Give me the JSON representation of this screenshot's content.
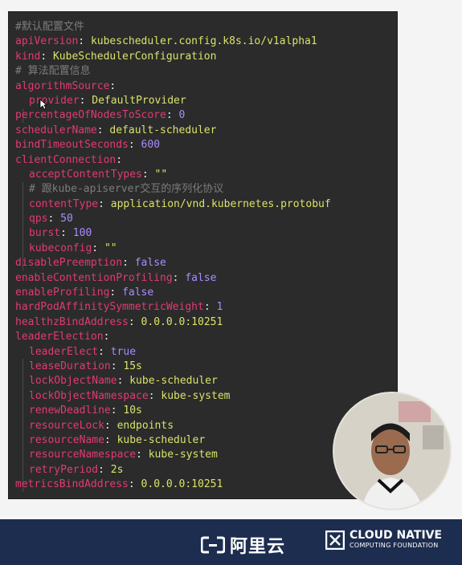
{
  "editor": {
    "lines": [
      {
        "indent": 0,
        "comment": "#默认配置文件"
      },
      {
        "indent": 0,
        "key": "apiVersion",
        "value": "kubescheduler.config.k8s.io/v1alpha1",
        "vtype": "v"
      },
      {
        "indent": 0,
        "key": "kind",
        "value": "KubeSchedulerConfiguration",
        "vtype": "v"
      },
      {
        "indent": 0,
        "comment": "# 算法配置信息"
      },
      {
        "indent": 0,
        "key": "algorithmSource",
        "value": "",
        "vtype": "v"
      },
      {
        "indent": 1,
        "key": "provider",
        "value": "DefaultProvider",
        "vtype": "v"
      },
      {
        "indent": 0,
        "key": "percentageOfNodesToScore",
        "value": "0",
        "vtype": "n"
      },
      {
        "indent": 0,
        "key": "schedulerName",
        "value": "default-scheduler",
        "vtype": "v"
      },
      {
        "indent": 0,
        "key": "bindTimeoutSeconds",
        "value": "600",
        "vtype": "n"
      },
      {
        "indent": 0,
        "key": "clientConnection",
        "value": "",
        "vtype": "v"
      },
      {
        "indent": 1,
        "key": "acceptContentTypes",
        "value": "\"\"",
        "vtype": "v"
      },
      {
        "indent": 1,
        "comment": "# 跟kube-apiserver交互的序列化协议"
      },
      {
        "indent": 1,
        "key": "contentType",
        "value": "application/vnd.kubernetes.protobuf",
        "vtype": "v"
      },
      {
        "indent": 1,
        "key": "qps",
        "value": "50",
        "vtype": "n"
      },
      {
        "indent": 1,
        "key": "burst",
        "value": "100",
        "vtype": "n"
      },
      {
        "indent": 1,
        "key": "kubeconfig",
        "value": "\"\"",
        "vtype": "v"
      },
      {
        "indent": 0,
        "key": "disablePreemption",
        "value": "false",
        "vtype": "n"
      },
      {
        "indent": 0,
        "key": "enableContentionProfiling",
        "value": "false",
        "vtype": "n"
      },
      {
        "indent": 0,
        "key": "enableProfiling",
        "value": "false",
        "vtype": "n"
      },
      {
        "indent": 0,
        "key": "hardPodAffinitySymmetricWeight",
        "value": "1",
        "vtype": "n"
      },
      {
        "indent": 0,
        "key": "healthzBindAddress",
        "value": "0.0.0.0:10251",
        "vtype": "v"
      },
      {
        "indent": 0,
        "key": "leaderElection",
        "value": "",
        "vtype": "v"
      },
      {
        "indent": 1,
        "key": "leaderElect",
        "value": "true",
        "vtype": "n"
      },
      {
        "indent": 1,
        "key": "leaseDuration",
        "value": "15s",
        "vtype": "v"
      },
      {
        "indent": 1,
        "key": "lockObjectName",
        "value": "kube-scheduler",
        "vtype": "v"
      },
      {
        "indent": 1,
        "key": "lockObjectNamespace",
        "value": "kube-system",
        "vtype": "v"
      },
      {
        "indent": 1,
        "key": "renewDeadline",
        "value": "10s",
        "vtype": "v"
      },
      {
        "indent": 1,
        "key": "resourceLock",
        "value": "endpoints",
        "vtype": "v"
      },
      {
        "indent": 1,
        "key": "resourceName",
        "value": "kube-scheduler",
        "vtype": "v"
      },
      {
        "indent": 1,
        "key": "resourceNamespace",
        "value": "kube-system",
        "vtype": "v"
      },
      {
        "indent": 1,
        "key": "retryPeriod",
        "value": "2s",
        "vtype": "v"
      },
      {
        "indent": 0,
        "key": "metricsBindAddress",
        "value": "0.0.0.0:10251",
        "vtype": "v"
      }
    ]
  },
  "footer": {
    "aliyun": "阿里云",
    "cncf_title": "CLOUD NATIVE",
    "cncf_sub": "COMPUTING FOUNDATION"
  },
  "colors": {
    "key": "#e23a73",
    "string": "#d9e36a",
    "number": "#a98cff",
    "comment": "#7c7c7c",
    "background": "#2b2b2b",
    "footer": "#1c2d4f"
  }
}
